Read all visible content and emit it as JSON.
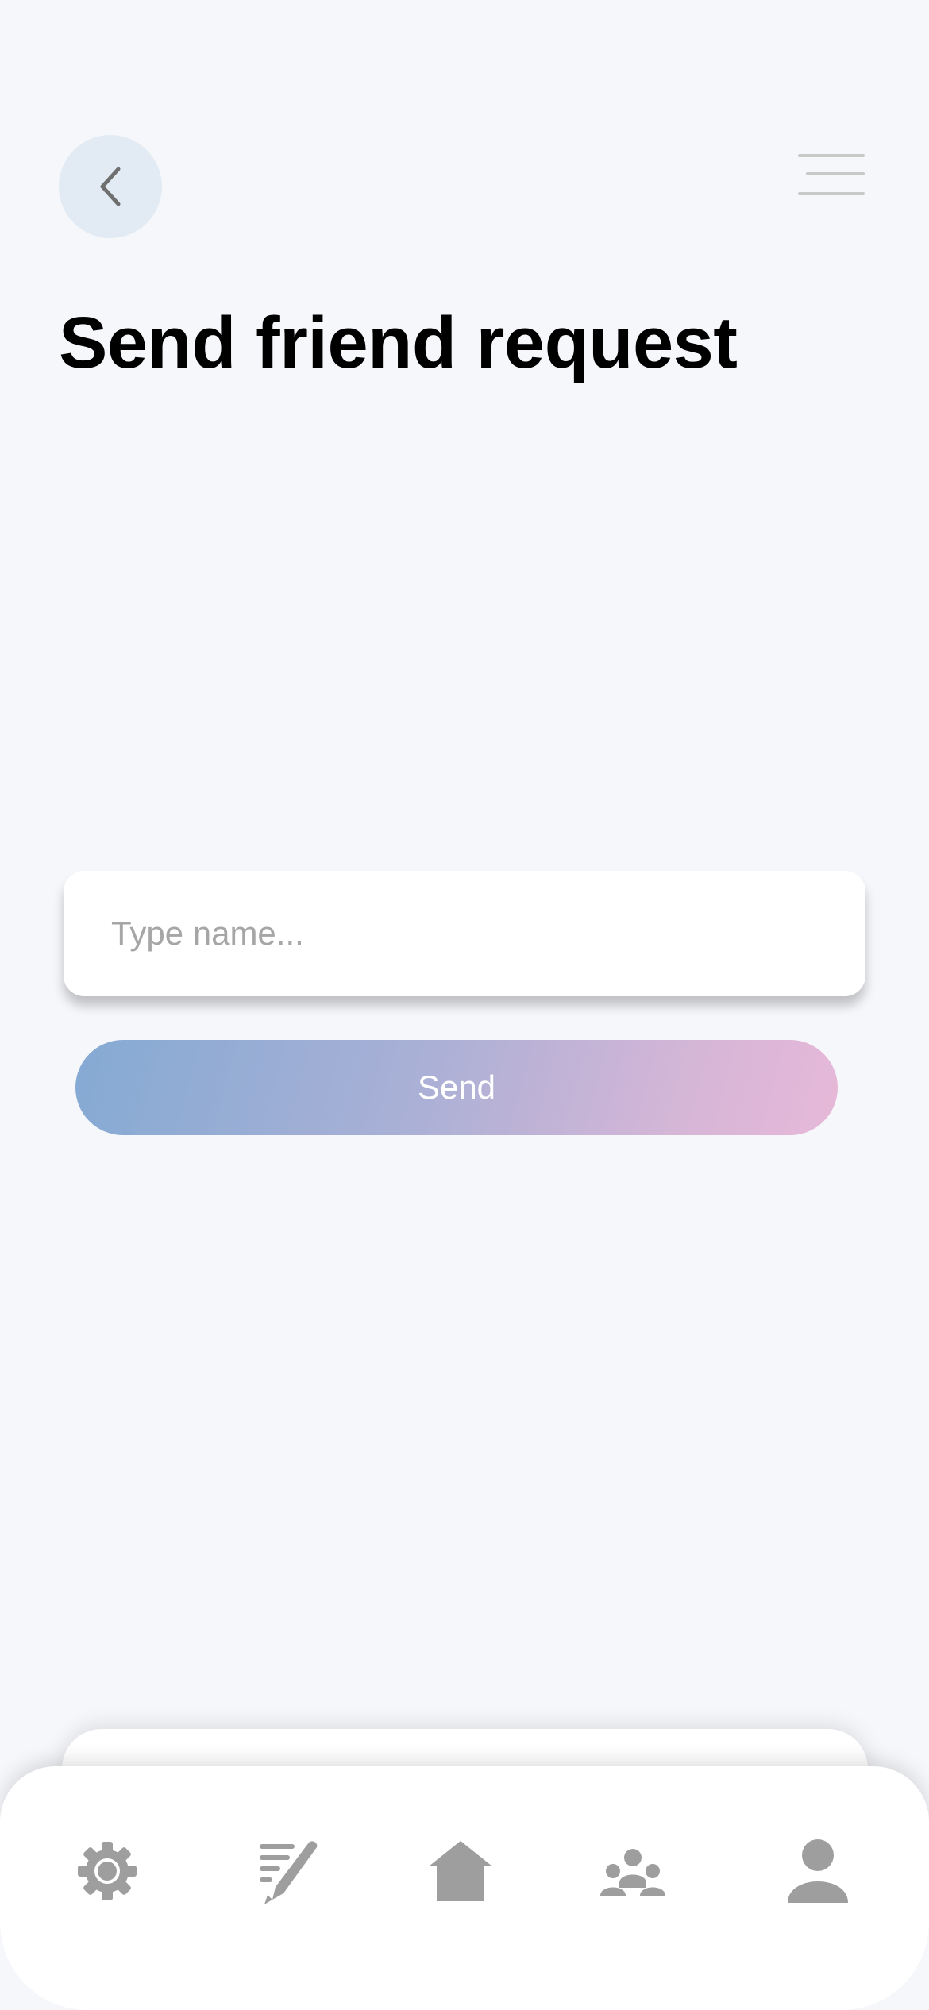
{
  "header": {
    "back_icon": "chevron-left-icon",
    "menu_icon": "hamburger-menu-icon",
    "title": "Send friend request"
  },
  "form": {
    "name_placeholder": "Type name...",
    "name_value": "",
    "send_label": "Send"
  },
  "colors": {
    "background": "#f6f7fb",
    "back_button_bg": "#e2ebf3",
    "send_gradient_start": "#84aad3",
    "send_gradient_end": "#e7b8d8",
    "tab_icon": "#9e9e9e"
  },
  "tab_bar": {
    "items": [
      {
        "icon": "gear-icon",
        "name": "settings"
      },
      {
        "icon": "edit-list-icon",
        "name": "posts"
      },
      {
        "icon": "home-icon",
        "name": "home"
      },
      {
        "icon": "group-icon",
        "name": "friends"
      },
      {
        "icon": "person-icon",
        "name": "profile"
      }
    ]
  }
}
